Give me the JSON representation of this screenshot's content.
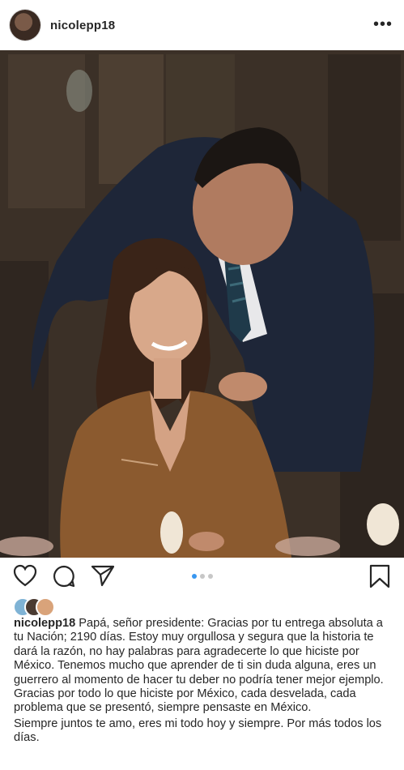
{
  "post": {
    "username": "nicolepp18",
    "more_label": "•••",
    "image_alt": "Photo of a young woman smiling up at a man in a suit",
    "icons": [
      "heart-icon",
      "comment-icon",
      "share-icon",
      "bookmark-icon",
      "more-icon"
    ],
    "carousel": {
      "count": 3,
      "active": 1
    },
    "caption": {
      "username": "nicolepp18",
      "paragraph1": "Papá, señor presidente: Gracias por tu entrega absoluta a tu Nación; 2190 días. Estoy muy orgullosa y segura que la historia te dará la razón, no hay palabras para agradecerte lo que hiciste por México. Tenemos mucho que aprender de ti sin duda alguna, eres un guerrero al momento de hacer tu deber no podría tener mejor ejemplo. Gracias por todo lo que hiciste por México, cada desvelada, cada problema que se presentó, siempre pensaste en México.",
      "paragraph2": "Siempre juntos te amo, eres mi todo hoy y siempre. Por más todos los días."
    }
  }
}
